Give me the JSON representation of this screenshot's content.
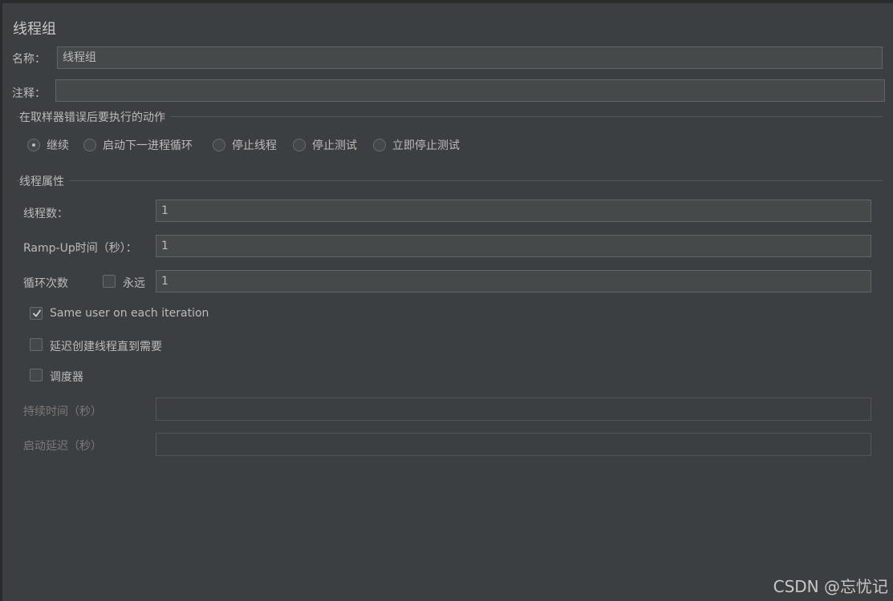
{
  "panel": {
    "title": "线程组"
  },
  "name_field": {
    "label": "名称：",
    "value": "线程组"
  },
  "comment_field": {
    "label": "注释：",
    "value": ""
  },
  "error_action": {
    "title": "在取样器错误后要执行的动作",
    "options": [
      {
        "label": "继续",
        "selected": true
      },
      {
        "label": "启动下一进程循环",
        "selected": false
      },
      {
        "label": "停止线程",
        "selected": false
      },
      {
        "label": "停止测试",
        "selected": false
      },
      {
        "label": "立即停止测试",
        "selected": false
      }
    ]
  },
  "thread_props": {
    "title": "线程属性",
    "num_threads": {
      "label": "线程数：",
      "value": "1"
    },
    "ramp_up": {
      "label": "Ramp-Up时间（秒）：",
      "value": "1"
    },
    "loop": {
      "label": "循环次数",
      "forever_label": "永远",
      "forever_checked": false,
      "value": "1"
    },
    "same_user": {
      "label": "Same user on each iteration",
      "checked": true
    },
    "delay_create": {
      "label": "延迟创建线程直到需要",
      "checked": false
    },
    "scheduler": {
      "label": "调度器",
      "checked": false
    },
    "duration": {
      "label": "持续时间（秒）",
      "value": ""
    },
    "startup_delay": {
      "label": "启动延迟（秒）",
      "value": ""
    }
  },
  "watermark": "CSDN @忘忧记"
}
